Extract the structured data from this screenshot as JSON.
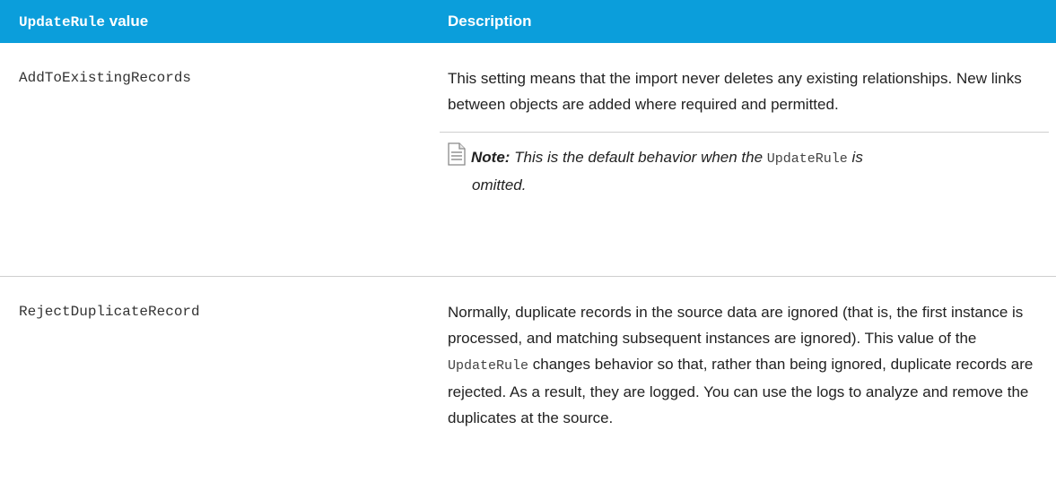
{
  "header": {
    "col1_code": "UpdateRule",
    "col1_text": " value",
    "col2": "Description"
  },
  "rows": [
    {
      "value": "AddToExistingRecords",
      "description": "This setting means that the import never deletes any existing relationships. New links between objects are added where required and permitted.",
      "note": {
        "icon": "note-icon",
        "label": "Note:",
        "text_before": " This is the default behavior when the ",
        "code": "UpdateRule",
        "text_after": " is",
        "text_after_line2": "omitted."
      }
    },
    {
      "value": "RejectDuplicateRecord",
      "description_before": "Normally, duplicate records in the source data are ignored (that is, the first instance is processed, and matching subsequent instances are ignored). This value of the ",
      "description_code": "UpdateRule",
      "description_after": " changes behavior so that, rather than being ignored, duplicate records are rejected. As a result, they are logged. You can use the logs to analyze and remove the duplicates at the source."
    }
  ],
  "colors": {
    "header_bg": "#0b9edb",
    "header_text": "#ffffff",
    "divider": "#cfcfcf"
  }
}
